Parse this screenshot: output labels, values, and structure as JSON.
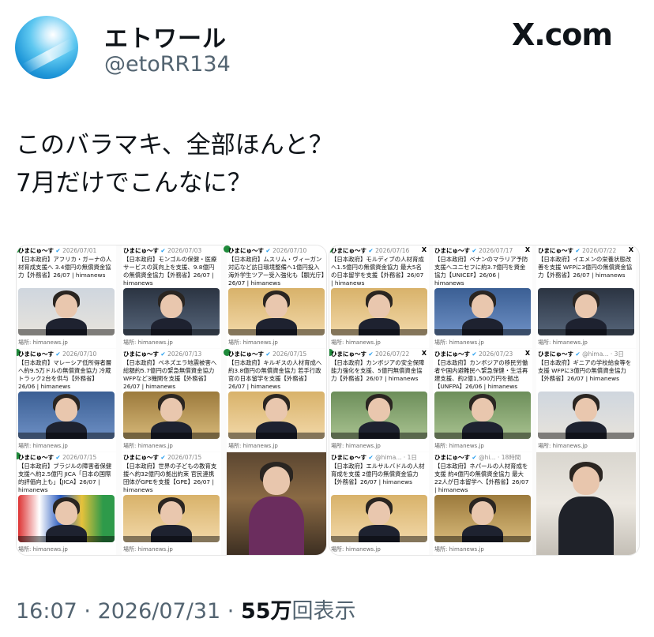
{
  "user": {
    "name": "エトワール",
    "handle": "@etoRR134"
  },
  "brand": {
    "logo_text": "X.com"
  },
  "tweet": {
    "line1": "このバラマキ、全部ほんと？",
    "line2": "7月だけでこんなに？"
  },
  "footer": {
    "time": "16:07",
    "sep1": " · ",
    "date": "2026/07/31",
    "sep2": " · ",
    "views": "55万",
    "views_label": "回表示"
  },
  "left_panel": {
    "cards": [
      {
        "account": "ひまにゅ〜す",
        "date": "2026/07/01",
        "text": "【日本政府】アフリカ・ガーナの人材育成支援へ 3.4億円の無償資金協力【外務省】26/07 | himanews",
        "source": "場所: himanews.jp"
      },
      {
        "account": "ひまにゅ〜す",
        "date": "2026/07/03",
        "text": "【日本政府】モンゴルの保健・医療サービスの質向上を支援、9.8億円の無償資金協力【外務省】26/07 | himanews",
        "source": "場所: himanews.jp"
      },
      {
        "account": "ひまにゅ〜す",
        "date": "2026/07/10",
        "text": "【日本政府】ムスリム・ヴィーガン対応など訪日環境整備へ1億円投入 海外学生ツアー受入強化も【観光庁】26/07 | himanews",
        "source": "場所: himanews.jp"
      },
      {
        "account": "ひまにゅ〜す",
        "date": "2026/07/10",
        "text": "【日本政府】マレーシア低所得者層へ約9.5万ドルの無償資金協力 冷蔵トラック2台を供与【外務省】26/06 | himanews",
        "source": "場所: himanews.jp"
      },
      {
        "account": "ひまにゅ〜す",
        "date": "2026/07/13",
        "text": "【日本政府】ベネズエラ地震被害へ総額約5.7億円の緊急無償資金協力 WFPなど3機関を支援【外務省】26/07 | himanews",
        "source": "場所: himanews.jp"
      },
      {
        "account": "ひまにゅ〜す",
        "date": "2026/07/15",
        "text": "【日本政府】キルギスの人材育成へ約3.8億円の無償資金協力 若手行政官の日本留学を支援【外務省】26/07 | himanews",
        "source": "場所: himanews.jp"
      },
      {
        "account": "ひまにゅ〜す",
        "date": "2026/07/15",
        "text": "【日本政府】ブラジルの障害者保健支援へ約2.5億円 JICA「日本の国際的評価向上も」【JICA】26/07 | himanews",
        "source": "場所: himanews.jp"
      },
      {
        "account": "ひまにゅ〜す",
        "date": "2026/07/15",
        "text": "【日本政府】世界の子どもの教育支援へ約32億円の拠出約束 官民連携団体がGPEを支援【GPE】26/07 | himanews",
        "source": "場所: himanews.jp"
      }
    ]
  },
  "right_panel": {
    "cards": [
      {
        "account": "ひまにゅ〜す",
        "date": "2026/07/16",
        "text": "【日本政府】モルディブの人材育成へ1.5億円の無償資金協力 最大5名の日本留学を支援【外務省】26/07 | himanews",
        "source": "場所: himanews.jp"
      },
      {
        "account": "ひまにゅ〜す",
        "date": "2026/07/17",
        "text": "【日本政府】ベナンのマラリア予防支援へユニセフに約3.7億円を資金協力【UNICEF】26/06 | himanews",
        "source": "場所: himanews.jp"
      },
      {
        "account": "ひまにゅ〜す",
        "date": "2026/07/22",
        "text": "【日本政府】イエメンの栄養状態改善を支援 WFPに3億円の無償資金協力【外務省】26/07 | himanews",
        "source": "場所: himanews.jp"
      },
      {
        "account": "ひまにゅ〜す",
        "date": "2026/07/22",
        "text": "【日本政府】カンボジアの安全保障能力強化を支援、5億円無償資金協力【外務省】26/07 | himanews",
        "source": "場所: himanews.jp"
      },
      {
        "account": "ひまにゅ〜す",
        "date": "2026/07/23",
        "text": "【日本政府】カンボジアの移民労働者や国内避難民へ緊急保健・生活再建支援、約2億1,500万円を拠出【UNFPA】26/06 | himanews",
        "source": "場所: himanews.jp"
      },
      {
        "account": "ひまにゅ〜す",
        "date": "@hima... · 3日",
        "text": "【日本政府】ギニアの学校給食等を支援 WFPに3億円の無償資金協力【外務省】26/07 | himanews",
        "source": "場所: himanews.jp"
      },
      {
        "account": "ひまにゅ〜す",
        "date": "@hima... · 1日",
        "text": "【日本政府】エルサルバドルの人材育成を支援 2億円の無償資金協力【外務省】26/07 | himanews",
        "source": "場所: himanews.jp"
      },
      {
        "account": "ひまにゅ〜す",
        "date": "@hi... · 18時間",
        "text": "【日本政府】ネパールの人材育成を支援 約4億円の無償資金協力 最大22人が日本留学へ【外務省】26/07 | himanews",
        "source": "場所: himanews.jp"
      }
    ]
  }
}
